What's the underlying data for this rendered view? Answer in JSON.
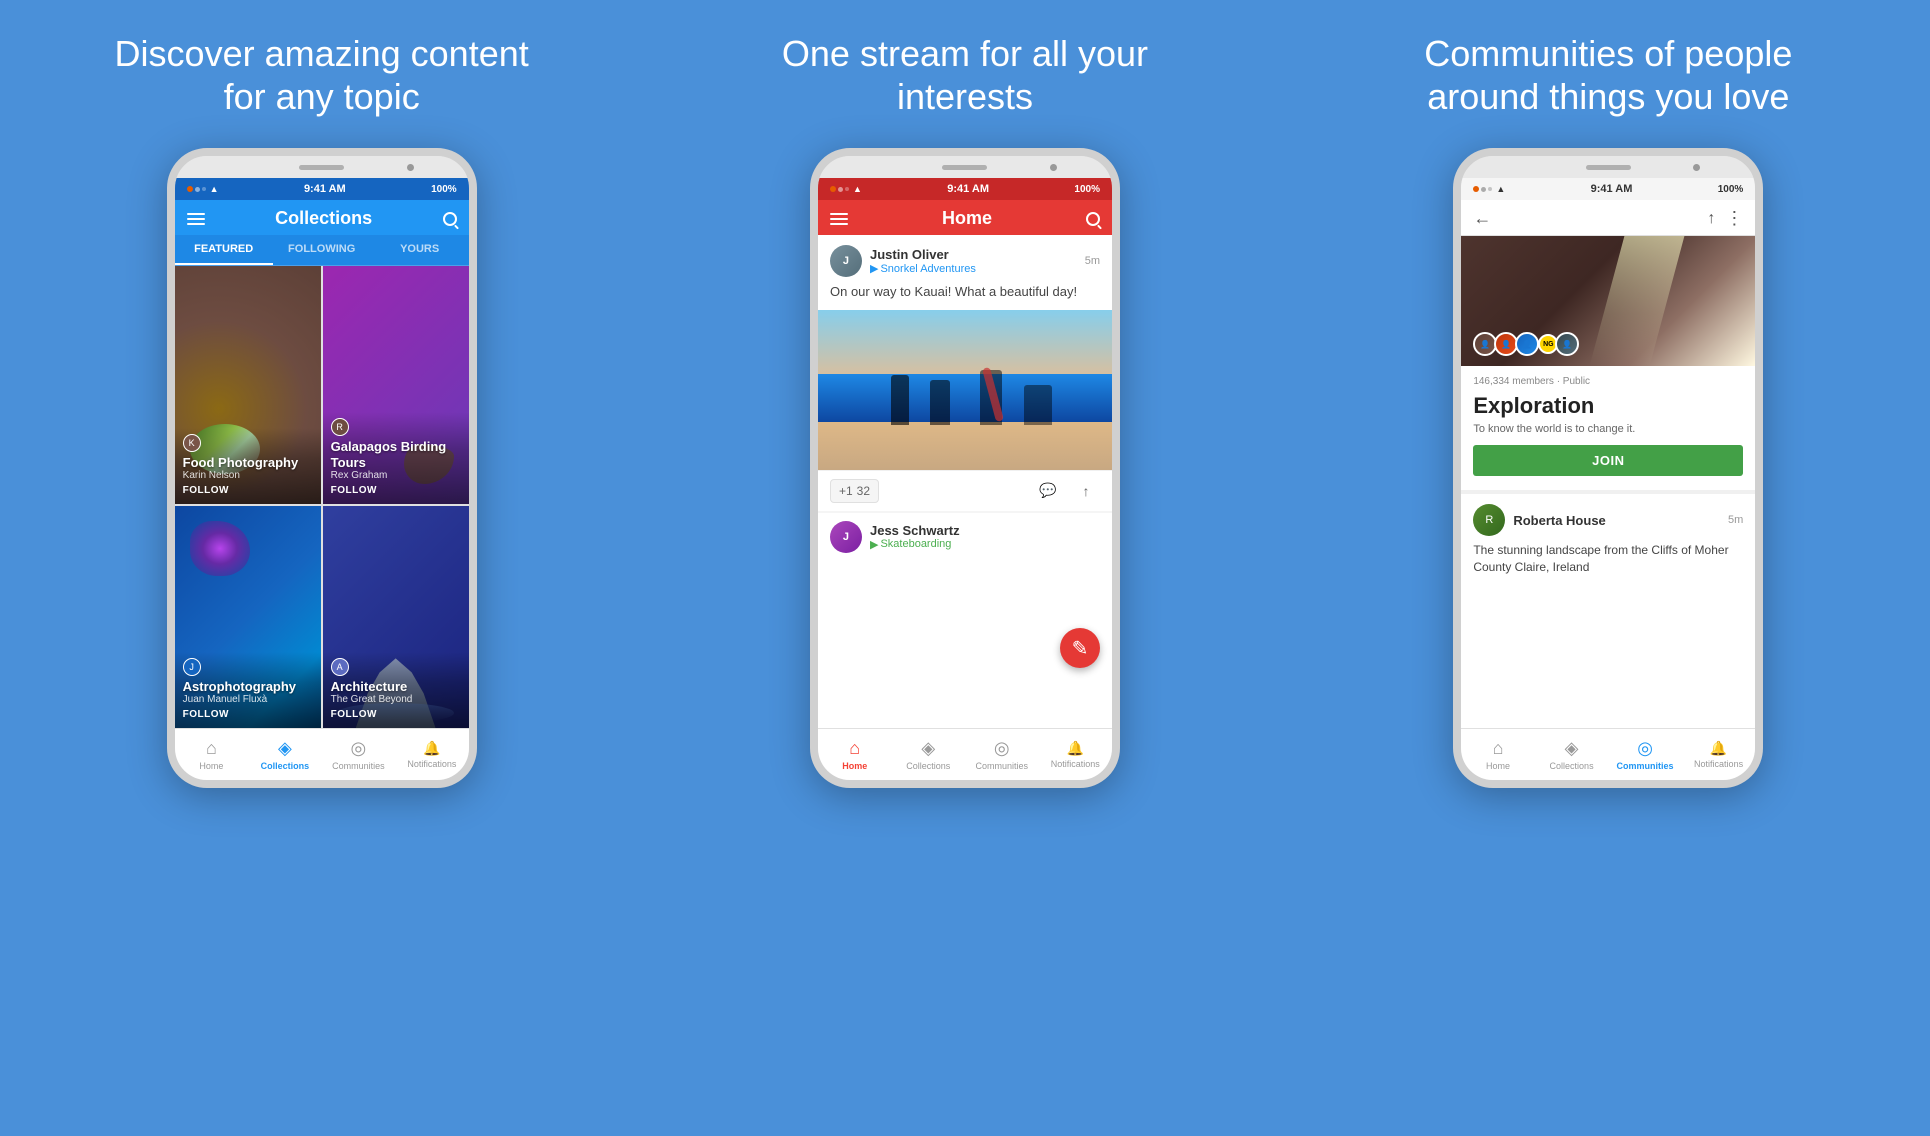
{
  "background_color": "#4A90D9",
  "panels": [
    {
      "id": "panel1",
      "heading": "Discover amazing content for any topic",
      "app": {
        "status_bar": {
          "dots": [
            "orange",
            "gray",
            "gray"
          ],
          "wifi": true,
          "time": "9:41 AM",
          "battery": "100%"
        },
        "header": {
          "title": "Collections",
          "color": "#2196F3"
        },
        "tabs": [
          "FEATURED",
          "FOLLOWING",
          "YOURS"
        ],
        "active_tab": 0,
        "collections": [
          {
            "title": "Food Photography",
            "author": "Karin Nelson",
            "action": "FOLLOW",
            "type": "food"
          },
          {
            "title": "Galapagos Birding Tours",
            "author": "Rex Graham",
            "action": "FOLLOW",
            "type": "birding"
          },
          {
            "title": "Astrophotography",
            "author": "Juan Manuel Fluxà",
            "action": "FOLLOW",
            "type": "astro"
          },
          {
            "title": "Architecture",
            "subtitle": "The Great Beyond",
            "action": "FOLLOW",
            "type": "arch"
          }
        ],
        "bottom_nav": [
          {
            "label": "Home",
            "active": false
          },
          {
            "label": "Collections",
            "active": true
          },
          {
            "label": "Communities",
            "active": false
          },
          {
            "label": "Notifications",
            "active": false
          }
        ]
      }
    },
    {
      "id": "panel2",
      "heading": "One stream for all your interests",
      "app": {
        "status_bar": {
          "time": "9:41 AM",
          "battery": "100%"
        },
        "header": {
          "title": "Home",
          "color": "#e53935"
        },
        "feed": [
          {
            "user": "Justin Oliver",
            "community": "Snorkel Adventures",
            "time": "5m",
            "text": "On our way to Kauai! What a beautiful day!",
            "has_image": true,
            "plus_count": "+1",
            "comment_count": "32"
          }
        ],
        "next_user": "Jess Schwartz",
        "next_community": "Skateboarding",
        "bottom_nav": [
          {
            "label": "Home",
            "active": true
          },
          {
            "label": "Collections",
            "active": false
          },
          {
            "label": "Communities",
            "active": false
          },
          {
            "label": "Notifications",
            "active": false
          }
        ]
      }
    },
    {
      "id": "panel3",
      "heading": "Communities of people around things you love",
      "app": {
        "status_bar": {
          "time": "9:41 AM",
          "battery": "100%"
        },
        "header": {
          "color": "white",
          "has_back": true
        },
        "community": {
          "name": "Exploration",
          "members": "146,334 members · Public",
          "description": "To know the world is to change it.",
          "join_label": "JOIN"
        },
        "post": {
          "user": "Roberta House",
          "time": "5m",
          "text": "The stunning landscape from the Cliffs of Moher County Claire, Ireland"
        },
        "bottom_nav": [
          {
            "label": "Home",
            "active": false
          },
          {
            "label": "Collections",
            "active": false
          },
          {
            "label": "Communities",
            "active": true
          },
          {
            "label": "Notifications",
            "active": false
          }
        ]
      }
    }
  ]
}
